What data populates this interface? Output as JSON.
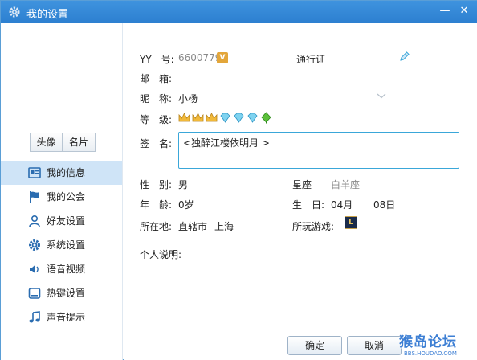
{
  "window": {
    "title": "我的设置",
    "minimize": "—",
    "close": "✕"
  },
  "sidebar": {
    "tabs": [
      {
        "label": "头像"
      },
      {
        "label": "名片"
      }
    ],
    "items": [
      {
        "label": "我的信息",
        "icon": "id-card-icon",
        "active": true
      },
      {
        "label": "我的公会",
        "icon": "flag-icon"
      },
      {
        "label": "好友设置",
        "icon": "person-icon"
      },
      {
        "label": "系统设置",
        "icon": "gear-icon"
      },
      {
        "label": "语音视频",
        "icon": "speaker-icon"
      },
      {
        "label": "热键设置",
        "icon": "keyboard-icon"
      },
      {
        "label": "声音提示",
        "icon": "music-note-icon"
      }
    ]
  },
  "profile": {
    "yy_label": "YY　号:",
    "yy_value": "6600779",
    "vip_badge": "V",
    "pass_label": "通行证",
    "mail_label": "邮　箱:",
    "nickname_label": "昵　称:",
    "nickname_value": "小杨",
    "level_label": "等　级:",
    "levels": [
      "crown",
      "crown",
      "crown",
      "diamond",
      "diamond",
      "diamond",
      "leaf"
    ],
    "signature_label": "签　名:",
    "signature_value": "<独醉江楼依明月 >",
    "gender_label": "性　别:",
    "gender_value": "男",
    "zodiac_label": "星座",
    "zodiac_value": "白羊座",
    "age_label": "年　龄:",
    "age_value": "0岁",
    "birthday_label": "生　日:",
    "birth_month": "04月",
    "birth_day": "08日",
    "location_label": "所在地:",
    "location_province": "直辖市",
    "location_city": "上海",
    "games_label": "所玩游戏:",
    "game_icon_text": "L",
    "bio_label": "个人说明:"
  },
  "buttons": {
    "ok": "确定",
    "cancel": "取消"
  },
  "watermark": {
    "main": "猴岛论坛",
    "sub": "BBS.HOUDAO.COM"
  },
  "colors": {
    "titlebar": "#2c7fd0",
    "accent": "#3aa7d9",
    "active_nav": "#cfe4f7"
  }
}
